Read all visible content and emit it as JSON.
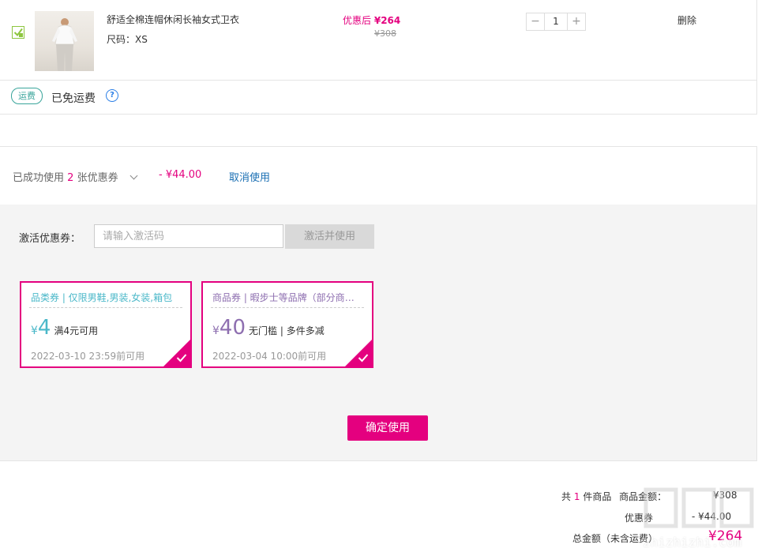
{
  "product": {
    "name": "舒适全棉连帽休闲长袖女式卫衣",
    "size_label": "尺码：XS",
    "price_prefix": "优惠后",
    "price": "¥264",
    "original_price": "¥308",
    "quantity": "1",
    "minus": "−",
    "plus": "+",
    "delete_label": "删除",
    "checked": true
  },
  "shipping": {
    "tag": "运费",
    "status": "已免运费",
    "help": "?"
  },
  "coupon_summary": {
    "prefix": "已成功使用",
    "count": "2",
    "suffix": "张优惠券",
    "discount": "- ¥44.00",
    "cancel_label": "取消使用"
  },
  "activation": {
    "label": "激活优惠券：",
    "placeholder": "请输入激活码",
    "button": "激活并使用"
  },
  "coupons": [
    {
      "title": "品类券 | 仅限男鞋,男装,女装,箱包",
      "yen": "¥",
      "amount": "4",
      "condition": "满4元可用",
      "date": "2022-03-10 23:59前可用",
      "selected": true,
      "color": "#4bb8c9"
    },
    {
      "title": "商品券 | 暇步士等品牌（部分商品）",
      "yen": "¥",
      "amount": "40",
      "condition": "无门槛 | 多件多减",
      "date": "2022-03-04 10:00前可用",
      "selected": true,
      "color": "#8e6fb0"
    }
  ],
  "confirm_label": "确定使用",
  "totals": {
    "count_prefix": "共",
    "count": "1",
    "count_suffix": "件商品",
    "amount_label": "商品金额：",
    "amount_value": "¥308",
    "discount_label": "优惠券",
    "discount_value": "- ¥44.00",
    "total_label": "总金额（未含运费）",
    "total_value": "¥264"
  },
  "watermark": "zhizhizhi.com",
  "colors": {
    "accent": "#e4007f",
    "link": "#1a6fb3",
    "shipping_tag": "#3aa59b"
  }
}
